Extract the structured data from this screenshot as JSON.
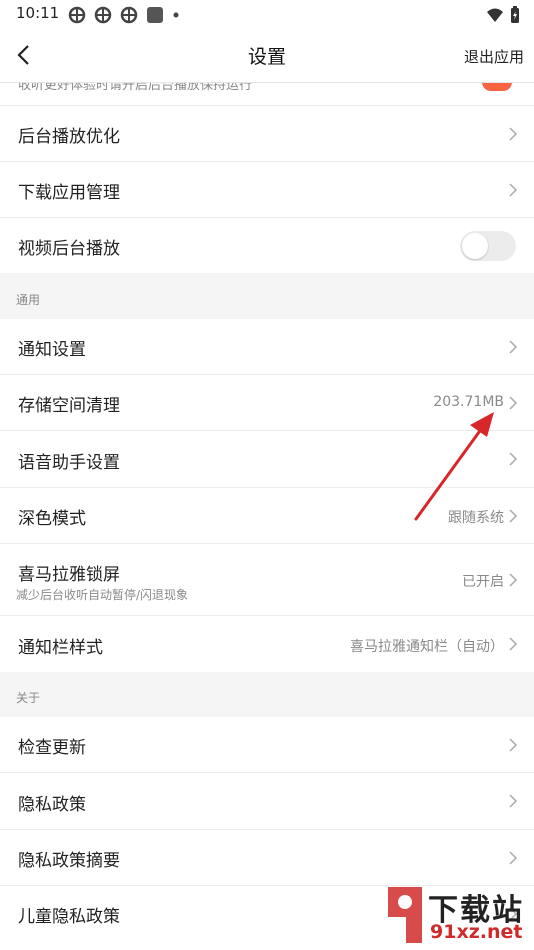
{
  "status_bar": {
    "time": "10:11"
  },
  "header": {
    "title": "设置",
    "exit_label": "退出应用"
  },
  "partial_row": {
    "text": "收听更好体验时请开启后台播放保持运行"
  },
  "rows_top": [
    {
      "label": "后台播放优化"
    },
    {
      "label": "下载应用管理"
    },
    {
      "label": "视频后台播放"
    }
  ],
  "section_general": {
    "label": "通用"
  },
  "rows_general": [
    {
      "label": "通知设置"
    },
    {
      "label": "存储空间清理",
      "value": "203.71MB"
    },
    {
      "label": "语音助手设置"
    },
    {
      "label": "深色模式",
      "value": "跟随系统"
    },
    {
      "label": "喜马拉雅锁屏",
      "sub": "减少后台收听自动暂停/闪退现象",
      "value": "已开启"
    },
    {
      "label": "通知栏样式",
      "value": "喜马拉雅通知栏（自动）"
    }
  ],
  "section_about": {
    "label": "关于"
  },
  "rows_about": [
    {
      "label": "检查更新"
    },
    {
      "label": "隐私政策"
    },
    {
      "label": "隐私政策摘要"
    },
    {
      "label": "儿童隐私政策"
    }
  ],
  "toggles": {
    "video_background_play": false
  },
  "colors": {
    "accent": "#f86442",
    "annotation_arrow": "#d9262b"
  },
  "watermark": {
    "line1": "下载站",
    "line2": "91xz.net"
  }
}
